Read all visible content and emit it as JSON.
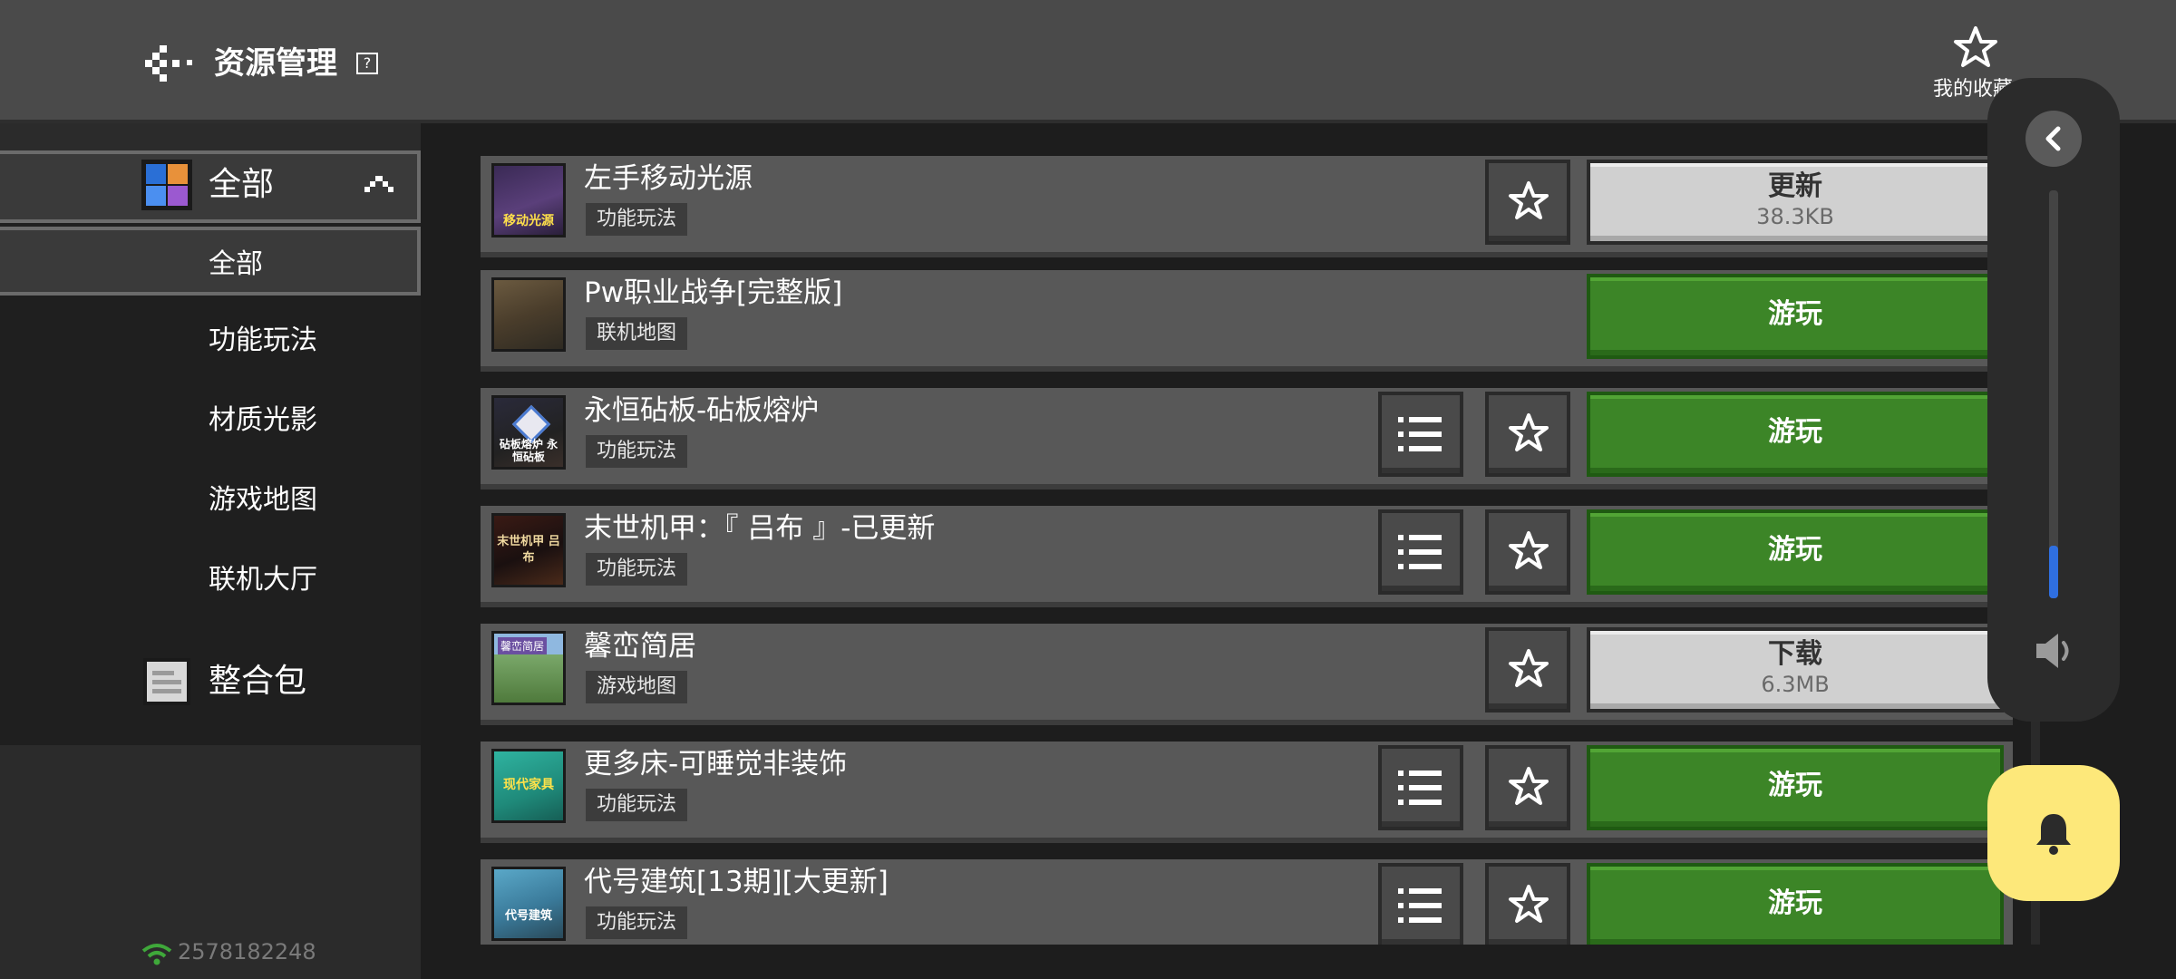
{
  "header": {
    "title": "资源管理",
    "help_glyph": "?",
    "favorites_label": "我的收藏"
  },
  "sidebar": {
    "category_all": "全部",
    "sub_items": [
      {
        "label": "全部",
        "active": true
      },
      {
        "label": "功能玩法",
        "active": false
      },
      {
        "label": "材质光影",
        "active": false
      },
      {
        "label": "游戏地图",
        "active": false
      },
      {
        "label": "联机大厅",
        "active": false
      }
    ],
    "pack_label": "整合包",
    "uid": "2578182248"
  },
  "rows": [
    {
      "title": "左手移动光源",
      "tag": "功能玩法",
      "has_menu": false,
      "has_fav": true,
      "action": "更新",
      "action_sub": "38.3KB",
      "action_style": "gray",
      "thumb_text": "移动光源"
    },
    {
      "title": "Pw职业战争[完整版]",
      "tag": "联机地图",
      "has_menu": false,
      "has_fav": false,
      "action": "游玩",
      "action_sub": "",
      "action_style": "green",
      "thumb_text": ""
    },
    {
      "title": "永恒砧板-砧板熔炉",
      "tag": "功能玩法",
      "has_menu": true,
      "has_fav": true,
      "action": "游玩",
      "action_sub": "",
      "action_style": "green",
      "thumb_text": "砧板熔炉 永恒砧板"
    },
    {
      "title": "末世机甲：『 吕布 』-已更新",
      "tag": "功能玩法",
      "has_menu": true,
      "has_fav": true,
      "action": "游玩",
      "action_sub": "",
      "action_style": "green",
      "thumb_text": "末世机甲 吕布"
    },
    {
      "title": "馨峦简居",
      "tag": "游戏地图",
      "has_menu": false,
      "has_fav": true,
      "action": "下载",
      "action_sub": "6.3MB",
      "action_style": "gray",
      "thumb_text": "馨峦简居"
    },
    {
      "title": "更多床-可睡觉非装饰",
      "tag": "功能玩法",
      "has_menu": true,
      "has_fav": true,
      "action": "游玩",
      "action_sub": "",
      "action_style": "green",
      "thumb_text": "现代家具"
    },
    {
      "title": "代号建筑[13期][大更新]",
      "tag": "功能玩法",
      "has_menu": true,
      "has_fav": true,
      "action": "游玩",
      "action_sub": "",
      "action_style": "green",
      "thumb_text": "代号建筑"
    }
  ],
  "volume": {
    "level": 0.13
  },
  "colors": {
    "play_green": "#3c8527",
    "accent_blue": "#2f6fe0",
    "bell_yellow": "#fde87a"
  },
  "icons": {
    "back": "back-arrow-icon",
    "favorite": "star-icon",
    "menu": "list-menu-icon",
    "speaker": "speaker-icon",
    "bell": "bell-icon",
    "wifi": "wifi-icon"
  }
}
